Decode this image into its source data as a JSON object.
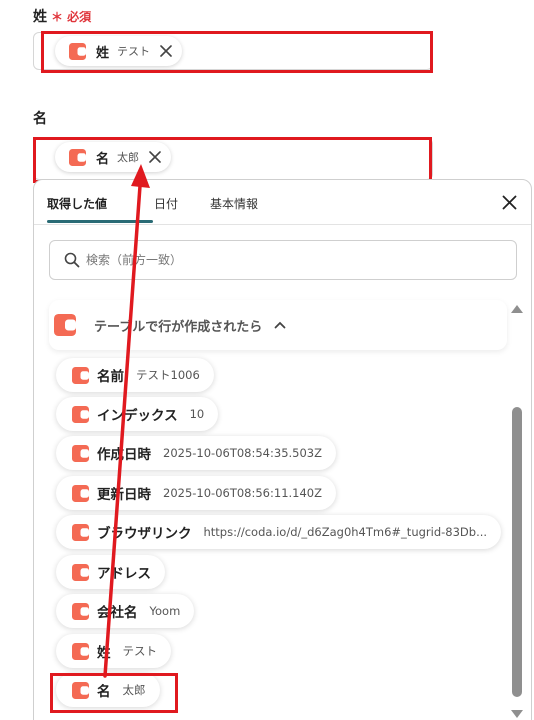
{
  "fields": {
    "last_name": {
      "label": "姓",
      "required_mark": "＊ 必須",
      "chip": {
        "label": "姓",
        "value": "テスト"
      }
    },
    "first_name": {
      "label": "名",
      "chip": {
        "label": "名",
        "value": "太郎"
      }
    }
  },
  "dropdown": {
    "tabs": [
      "取得した値",
      "日付",
      "基本情報"
    ],
    "active_tab": "取得した値",
    "search_placeholder": "検索（前方一致）",
    "group_title": "テーブルで行が作成されたら",
    "items": [
      {
        "label": "名前",
        "value": "テスト1006"
      },
      {
        "label": "インデックス",
        "value": "10"
      },
      {
        "label": "作成日時",
        "value": "2025-10-06T08:54:35.503Z"
      },
      {
        "label": "更新日時",
        "value": "2025-10-06T08:56:11.140Z"
      },
      {
        "label": "ブラウザリンク",
        "value": "https://coda.io/d/_d6Zag0h4Tm6#_tugrid-83Db..."
      },
      {
        "label": "アドレス",
        "value": ""
      },
      {
        "label": "会社名",
        "value": "Yoom"
      },
      {
        "label": "姓",
        "value": "テスト"
      },
      {
        "label": "名",
        "value": "太郎"
      }
    ]
  },
  "icons": {
    "app_logo": "coda-logo-icon",
    "close": "close-icon",
    "search": "search-icon",
    "chevron": "chevron-up-icon"
  },
  "colors": {
    "brand": "#f46a54",
    "highlight": "#e0191f",
    "tab_underline": "#2a6b75"
  }
}
